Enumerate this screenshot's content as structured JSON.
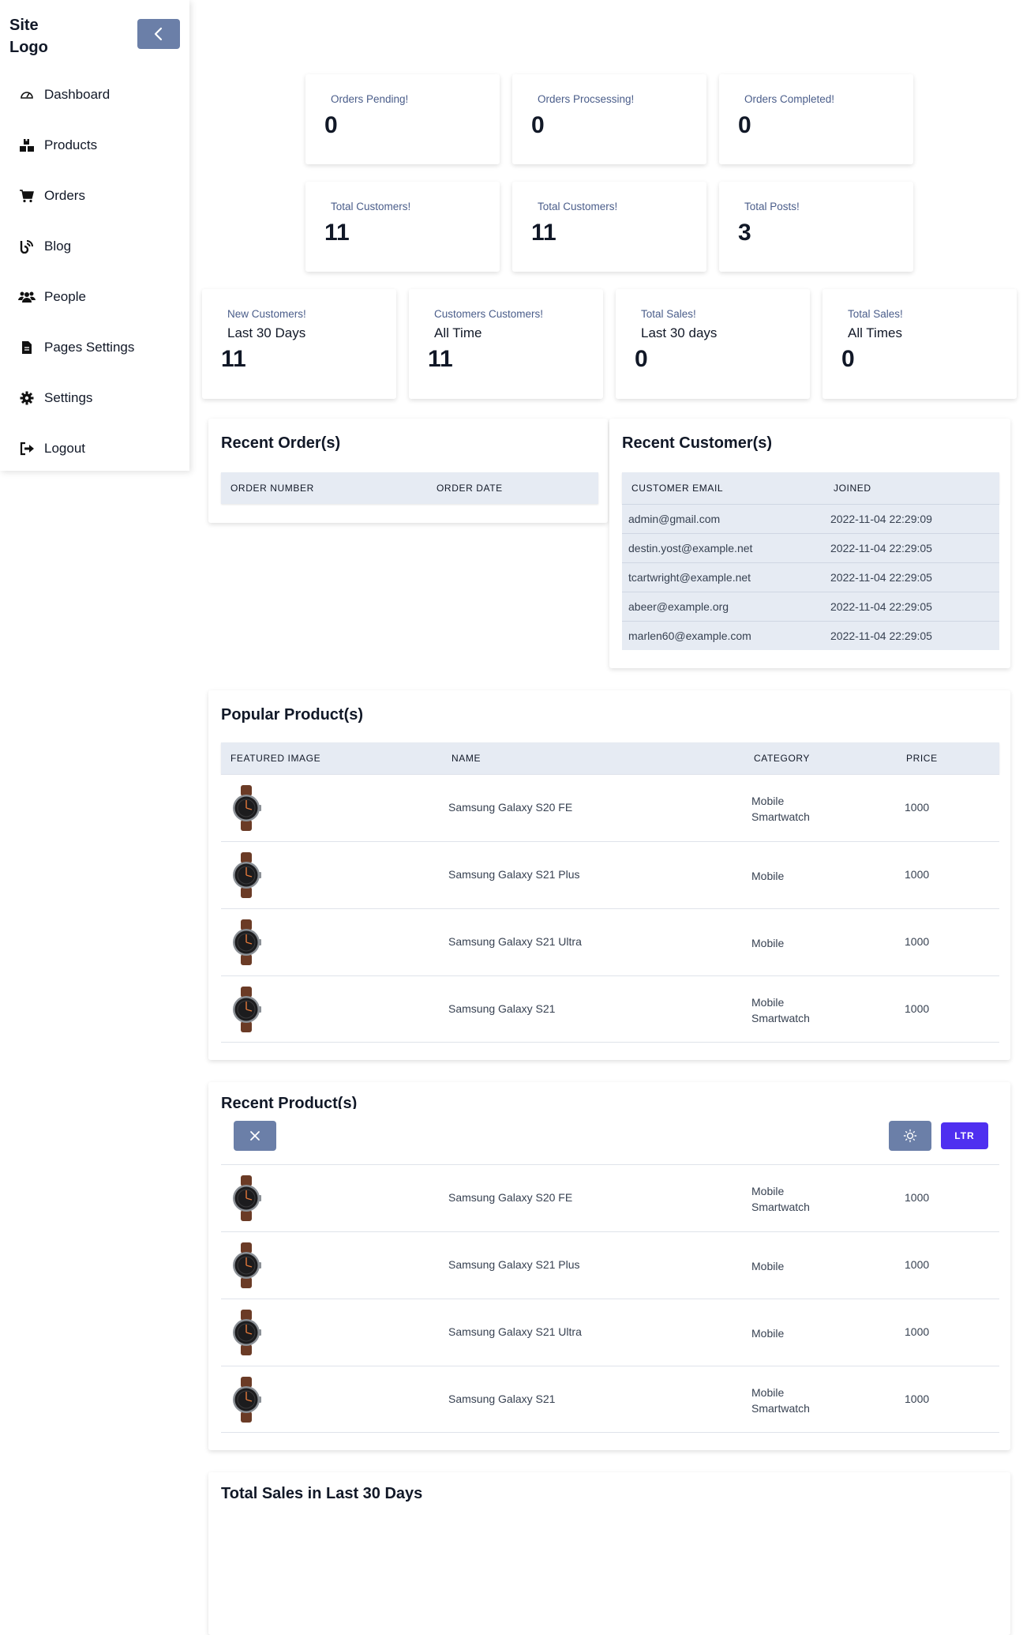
{
  "sidebar": {
    "logo": "Site Logo",
    "collapse_icon": "chevron-left-icon",
    "items": [
      {
        "label": "Dashboard",
        "icon": "dashboard-gauge-icon"
      },
      {
        "label": "Products",
        "icon": "boxes-icon"
      },
      {
        "label": "Orders",
        "icon": "cart-icon"
      },
      {
        "label": "Blog",
        "icon": "blog-icon"
      },
      {
        "label": "People",
        "icon": "users-icon"
      },
      {
        "label": "Pages Settings",
        "icon": "file-icon"
      },
      {
        "label": "Settings",
        "icon": "gear-icon"
      },
      {
        "label": "Logout",
        "icon": "logout-icon"
      }
    ]
  },
  "stats_row1": [
    {
      "label": "Orders Pending!",
      "value": "0"
    },
    {
      "label": "Orders Procsessing!",
      "value": "0"
    },
    {
      "label": "Orders Completed!",
      "value": "0"
    }
  ],
  "stats_row2": [
    {
      "label": "Total Customers!",
      "value": "11"
    },
    {
      "label": "Total Customers!",
      "value": "11"
    },
    {
      "label": "Total Posts!",
      "value": "3"
    }
  ],
  "stats_row3": [
    {
      "label": "New Customers!",
      "sub": "Last 30 Days",
      "value": "11"
    },
    {
      "label": "Customers Customers!",
      "sub": "All Time",
      "value": "11"
    },
    {
      "label": "Total Sales!",
      "sub": "Last 30 days",
      "value": "0"
    },
    {
      "label": "Total Sales!",
      "sub": "All Times",
      "value": "0"
    }
  ],
  "recent_orders": {
    "title": "Recent Order(s)",
    "headers": [
      "ORDER NUMBER",
      "ORDER DATE"
    ]
  },
  "recent_customers": {
    "title": "Recent Customer(s)",
    "headers": [
      "CUSTOMER EMAIL",
      "JOINED"
    ],
    "rows": [
      {
        "email": "admin@gmail.com",
        "joined": "2022-11-04 22:29:09"
      },
      {
        "email": "destin.yost@example.net",
        "joined": "2022-11-04 22:29:05"
      },
      {
        "email": "tcartwright@example.net",
        "joined": "2022-11-04 22:29:05"
      },
      {
        "email": "abeer@example.org",
        "joined": "2022-11-04 22:29:05"
      },
      {
        "email": "marlen60@example.com",
        "joined": "2022-11-04 22:29:05"
      }
    ]
  },
  "popular_products": {
    "title": "Popular Product(s)",
    "headers": [
      "FEATURED IMAGE",
      "NAME",
      "CATEGORY",
      "PRICE"
    ],
    "rows": [
      {
        "name": "Samsung Galaxy S20 FE",
        "category": [
          "Mobile",
          "Smartwatch"
        ],
        "price": "1000"
      },
      {
        "name": "Samsung Galaxy S21 Plus",
        "category": [
          "Mobile"
        ],
        "price": "1000"
      },
      {
        "name": "Samsung Galaxy S21 Ultra",
        "category": [
          "Mobile"
        ],
        "price": "1000"
      },
      {
        "name": "Samsung Galaxy S21",
        "category": [
          "Mobile",
          "Smartwatch"
        ],
        "price": "1000"
      }
    ]
  },
  "recent_products": {
    "title": "Recent Product(s)",
    "rows": [
      {
        "name": "Samsung Galaxy S20 FE",
        "category": [
          "Mobile",
          "Smartwatch"
        ],
        "price": "1000"
      },
      {
        "name": "Samsung Galaxy S21 Plus",
        "category": [
          "Mobile"
        ],
        "price": "1000"
      },
      {
        "name": "Samsung Galaxy S21 Ultra",
        "category": [
          "Mobile"
        ],
        "price": "1000"
      },
      {
        "name": "Samsung Galaxy S21",
        "category": [
          "Mobile",
          "Smartwatch"
        ],
        "price": "1000"
      }
    ]
  },
  "floating_toolbar": {
    "close_icon": "close-icon",
    "theme_icon": "sun-icon",
    "direction_label": "LTR"
  },
  "sales_chart": {
    "title": "Total Sales in Last 30 Days"
  },
  "colors": {
    "accent": "#4f2ff0",
    "slate_button": "#6b7fa8",
    "table_header": "#e6ebf3",
    "label_text": "#4a5d8a"
  }
}
